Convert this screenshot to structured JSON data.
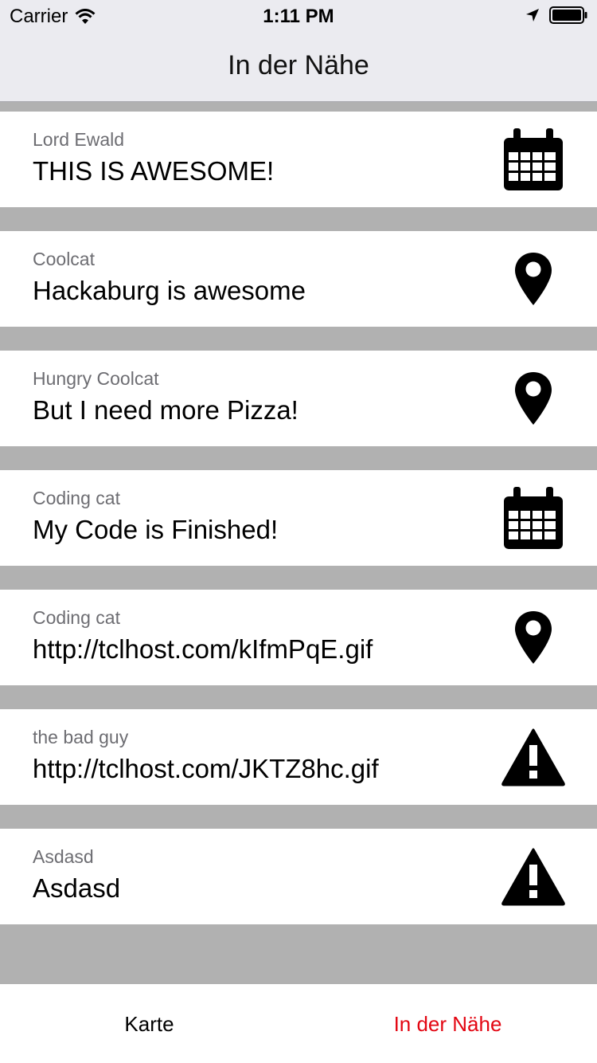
{
  "status_bar": {
    "carrier": "Carrier",
    "time": "1:11 PM"
  },
  "nav": {
    "title": "In der Nähe"
  },
  "feed": [
    {
      "author": "Lord Ewald",
      "message": "THIS IS AWESOME!",
      "icon": "calendar-icon"
    },
    {
      "author": "Coolcat",
      "message": "Hackaburg is awesome",
      "icon": "map-pin-icon"
    },
    {
      "author": "Hungry Coolcat",
      "message": "But I need more Pizza!",
      "icon": "map-pin-icon"
    },
    {
      "author": "Coding cat",
      "message": "My Code is Finished!",
      "icon": "calendar-icon"
    },
    {
      "author": "Coding cat",
      "message": "http://tclhost.com/kIfmPqE.gif",
      "icon": "map-pin-icon"
    },
    {
      "author": "the bad guy",
      "message": "http://tclhost.com/JKTZ8hc.gif",
      "icon": "warning-icon"
    },
    {
      "author": "Asdasd",
      "message": "Asdasd",
      "icon": "warning-icon"
    }
  ],
  "tabs": [
    {
      "label": "Karte",
      "active": false
    },
    {
      "label": "In der Nähe",
      "active": true
    }
  ],
  "colors": {
    "accent": "#e30612",
    "separator": "#b1b1b1",
    "bar_background": "#ebebf0"
  }
}
